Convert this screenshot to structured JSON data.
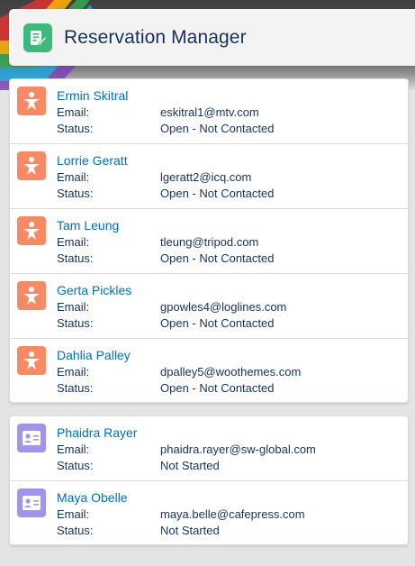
{
  "header": {
    "title": "Reservation Manager",
    "icon": "reservation-note-icon"
  },
  "labels": {
    "email": "Email:",
    "status": "Status:"
  },
  "colors": {
    "lead_badge": "#f88962",
    "contact_badge": "#a094ed",
    "app_icon": "#3bba7c",
    "link": "#006dcc"
  },
  "leads": [
    {
      "name": "Ermin Skitral",
      "email": "eskitral1@mtv.com",
      "status": "Open - Not Contacted",
      "icon": "lead-icon"
    },
    {
      "name": "Lorrie Geratt",
      "email": "lgeratt2@icq.com",
      "status": "Open - Not Contacted",
      "icon": "lead-icon"
    },
    {
      "name": "Tam Leung",
      "email": "tleung@tripod.com",
      "status": "Open - Not Contacted",
      "icon": "lead-icon"
    },
    {
      "name": "Gerta Pickles",
      "email": "gpowles4@loglines.com",
      "status": "Open - Not Contacted",
      "icon": "lead-icon"
    },
    {
      "name": "Dahlia Palley",
      "email": "dpalley5@woothemes.com",
      "status": "Open - Not Contacted",
      "icon": "lead-icon"
    }
  ],
  "contacts": [
    {
      "name": "Phaidra Rayer",
      "email": "phaidra.rayer@sw-global.com",
      "status": "Not Started",
      "icon": "contact-card-icon"
    },
    {
      "name": "Maya Obelle",
      "email": "maya.belle@cafepress.com",
      "status": "Not Started",
      "icon": "contact-card-icon"
    }
  ]
}
